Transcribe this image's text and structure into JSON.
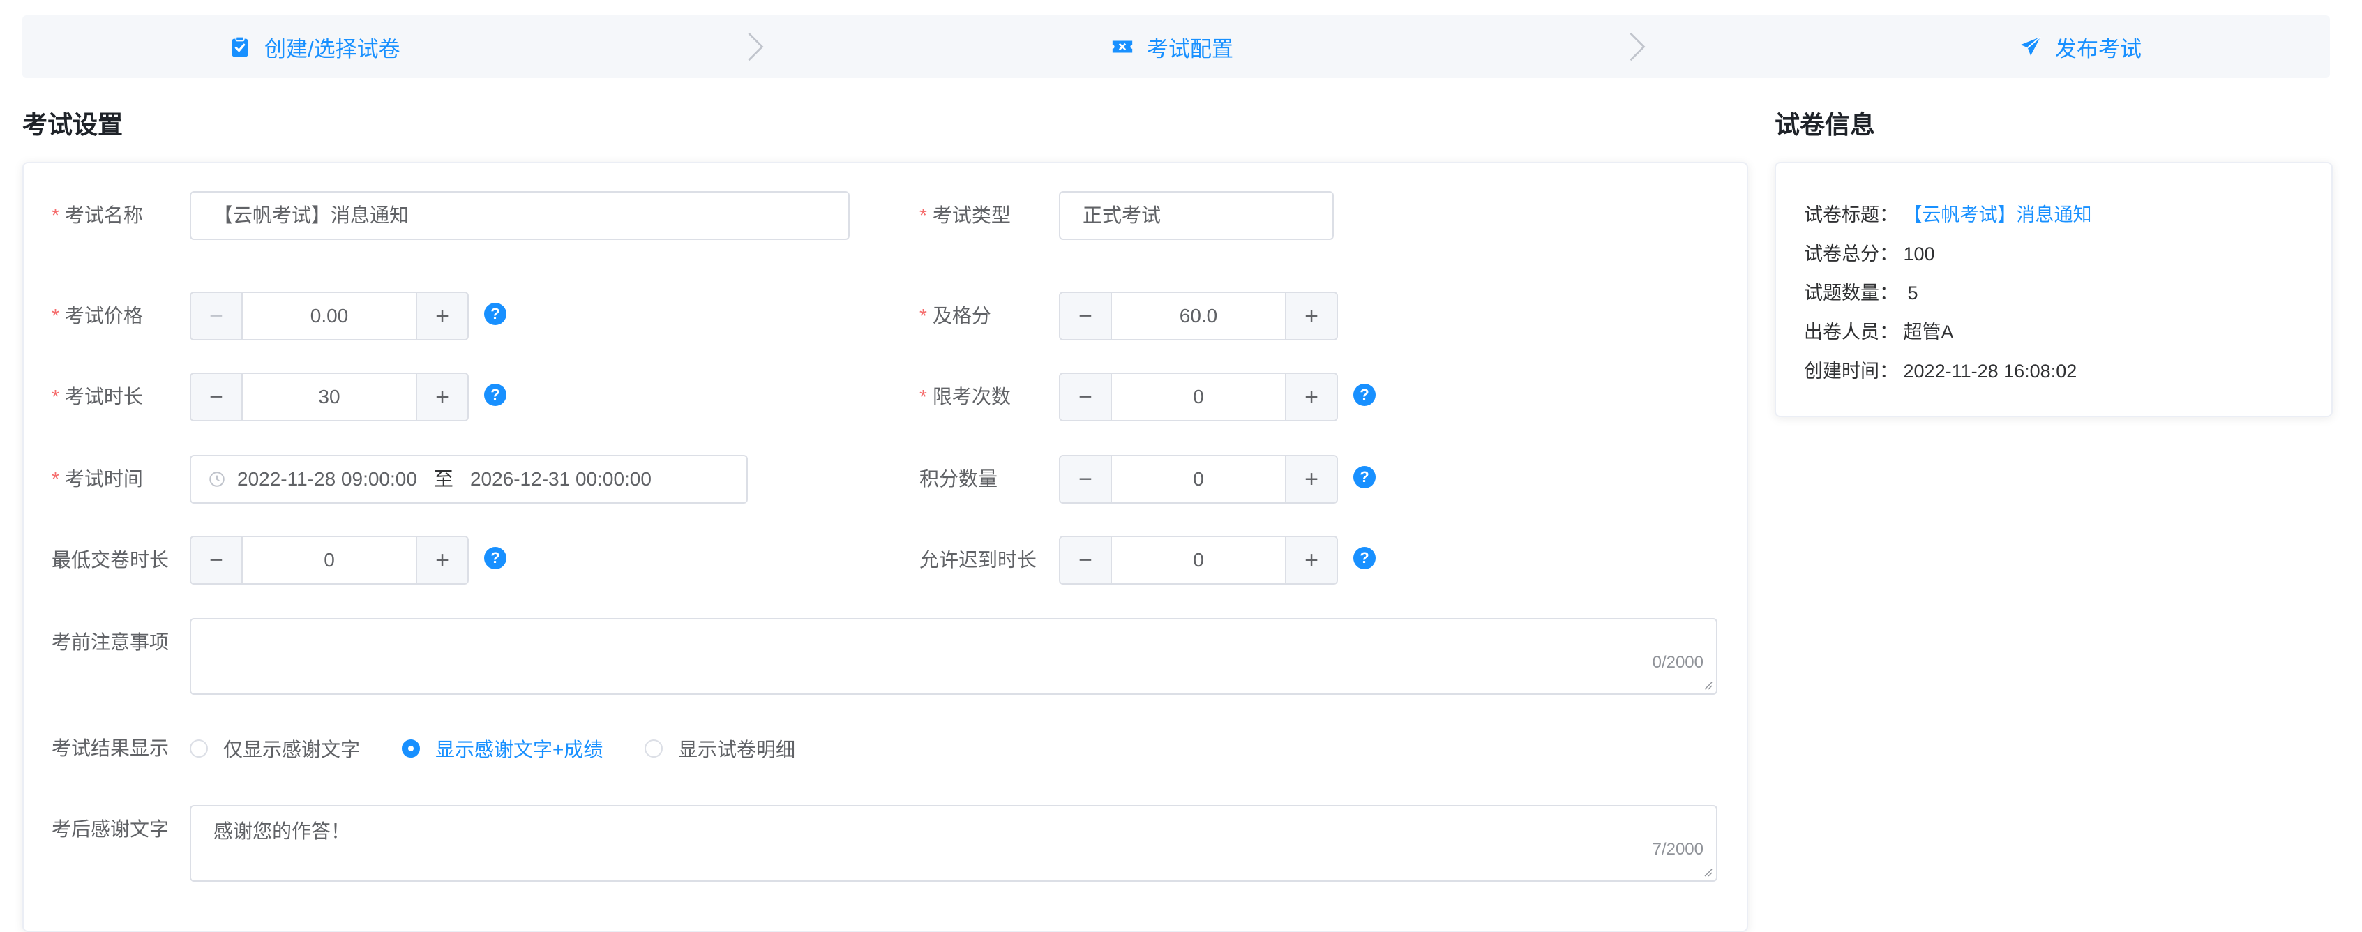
{
  "steps": [
    {
      "label": "创建/选择试卷",
      "icon": "clipboard-check-icon"
    },
    {
      "label": "考试配置",
      "icon": "ticket-icon"
    },
    {
      "label": "发布考试",
      "icon": "paper-plane-icon"
    }
  ],
  "exam_settings": {
    "title": "考试设置",
    "exam_name": {
      "label": "考试名称",
      "value": "【云帆考试】消息通知"
    },
    "exam_type": {
      "label": "考试类型",
      "value": "正式考试"
    },
    "price": {
      "label": "考试价格",
      "value": "0.00"
    },
    "pass_score": {
      "label": "及格分",
      "value": "60.0"
    },
    "duration": {
      "label": "考试时长",
      "value": "30"
    },
    "attempt_limit": {
      "label": "限考次数",
      "value": "0"
    },
    "exam_time": {
      "label": "考试时间",
      "start": "2022-11-28 09:00:00",
      "separator": "至",
      "end": "2026-12-31 00:00:00"
    },
    "points": {
      "label": "积分数量",
      "value": "0"
    },
    "min_submit": {
      "label": "最低交卷时长",
      "value": "0"
    },
    "late_allow": {
      "label": "允许迟到时长",
      "value": "0"
    },
    "notice": {
      "label": "考前注意事项",
      "value": "",
      "count": "0/2000"
    },
    "result_display": {
      "label": "考试结果显示",
      "options": [
        "仅显示感谢文字",
        "显示感谢文字+成绩",
        "显示试卷明细"
      ],
      "selected": "显示感谢文字+成绩"
    },
    "thanks": {
      "label": "考后感谢文字",
      "value": "感谢您的作答！",
      "count": "7/2000"
    },
    "help_glyph": "?",
    "minus_glyph": "−",
    "plus_glyph": "+"
  },
  "paper_info": {
    "title": "试卷信息",
    "paper_title": {
      "label": "试卷标题：",
      "value": "【云帆考试】消息通知"
    },
    "total_score": {
      "label": "试卷总分：",
      "value": "100"
    },
    "question_count": {
      "label": "试题数量：",
      "value": "5"
    },
    "author": {
      "label": "出卷人员：",
      "value": "超管A"
    },
    "created_at": {
      "label": "创建时间：",
      "value": "2022-11-28 16:08:02"
    }
  },
  "colors": {
    "accent": "#1890ff",
    "required": "#f56c6c",
    "border": "#dcdfe6",
    "step_bg": "#f5f7fa"
  }
}
